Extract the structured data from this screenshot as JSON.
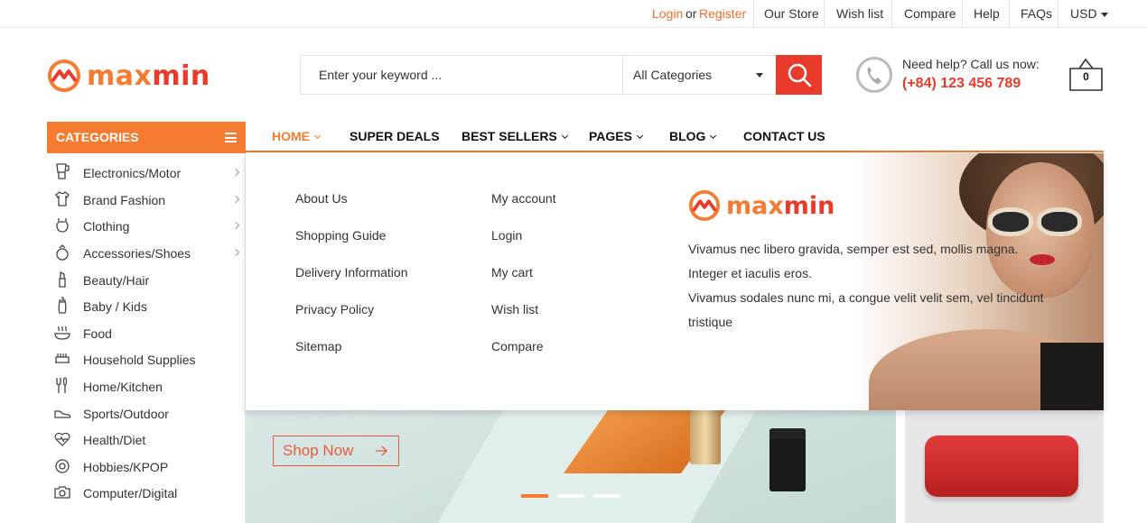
{
  "topbar": {
    "login": "Login",
    "or": "or",
    "register": "Register",
    "our_store": "Our Store",
    "wish_list": "Wish list",
    "compare": "Compare",
    "help": "Help",
    "faqs": "FAQs",
    "currency": "USD"
  },
  "brand": {
    "part1": "max",
    "part2": "min"
  },
  "search": {
    "placeholder": "Enter your keyword ...",
    "category": "All Categories"
  },
  "help": {
    "label": "Need help? Call us now:",
    "phone": "(+84) 123 456 789"
  },
  "cart": {
    "count": "0"
  },
  "categories": {
    "title": "CATEGORIES",
    "items": [
      {
        "label": "Electronics/Motor",
        "icon": "blender-icon"
      },
      {
        "label": "Brand Fashion",
        "icon": "tshirt-icon"
      },
      {
        "label": "Clothing",
        "icon": "dress-icon"
      },
      {
        "label": "Accessories/Shoes",
        "icon": "ring-icon"
      },
      {
        "label": "Beauty/Hair",
        "icon": "lipstick-icon"
      },
      {
        "label": "Baby / Kids",
        "icon": "baby-bottle-icon"
      },
      {
        "label": "Food",
        "icon": "food-icon"
      },
      {
        "label": "Household Supplies",
        "icon": "household-icon"
      },
      {
        "label": "Home/Kitchen",
        "icon": "kitchen-icon"
      },
      {
        "label": "Sports/Outdoor",
        "icon": "shoe-icon"
      },
      {
        "label": "Health/Diet",
        "icon": "heart-pulse-icon"
      },
      {
        "label": "Hobbies/KPOP",
        "icon": "hobby-icon"
      },
      {
        "label": "Computer/Digital",
        "icon": "camera-icon"
      }
    ]
  },
  "nav": {
    "home": "HOME",
    "super_deals": "SUPER DEALS",
    "best_sellers": "BEST SELLERS",
    "pages": "PAGES",
    "blog": "BLOG",
    "contact": "CONTACT US"
  },
  "mega": {
    "col1": [
      "About Us",
      "Shopping Guide",
      "Delivery Information",
      "Privacy Policy",
      "Sitemap"
    ],
    "col2": [
      "My account",
      "Login",
      "My cart",
      "Wish list",
      "Compare"
    ],
    "text1": "Vivamus nec libero gravida, semper est sed, mollis magna. Integer et iaculis eros.",
    "text2": "Vivamus sodales nunc mi, a congue velit velit sem, vel tincidunt tristique"
  },
  "banner": {
    "shop_now": "Shop Now"
  },
  "colors": {
    "accent": "#f47b2f",
    "red": "#ea3a2b"
  }
}
